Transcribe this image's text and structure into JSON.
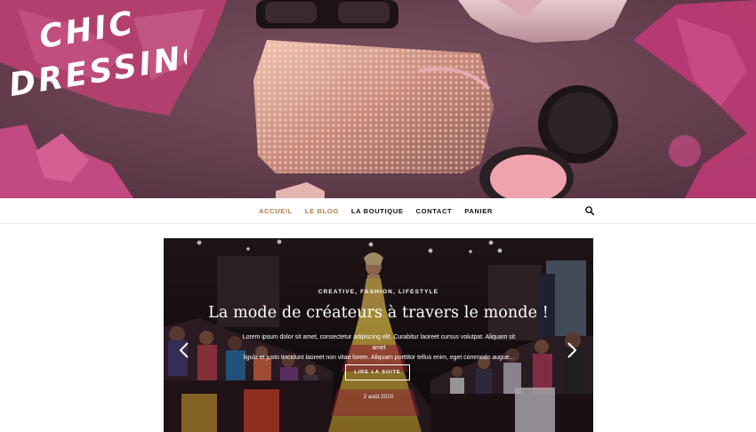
{
  "header": {
    "logo_line1": "CHIC",
    "logo_line2": "DRESSING"
  },
  "nav": {
    "items": [
      {
        "label": "ACCUEIL",
        "active": true
      },
      {
        "label": "LE BLOG",
        "active": true
      },
      {
        "label": "LA BOUTIQUE",
        "active": false
      },
      {
        "label": "CONTACT",
        "active": false
      },
      {
        "label": "PANIER",
        "active": false
      }
    ],
    "search_icon": "search-icon"
  },
  "slider": {
    "categories": "CREATIVE, FASHION, LIFESTYLE",
    "title": "La mode de créateurs à travers le monde !",
    "excerpt_line1": "Lorem ipsum dolor sit amet, consectetur adipiscing elit. Curabitur laoreet cursus volutpat. Aliquam sit amet",
    "excerpt_line2": "ligula et justo tincidunt laoreet non vitae lorem. Aliquam porttitor tellus enim, eget commodo augue...",
    "read_more": "LIRE LA SUITE",
    "date": "2 août 2020",
    "prev_icon": "chevron-left-icon",
    "next_icon": "chevron-right-icon"
  },
  "colors": {
    "accent": "#b07d47",
    "hero_bg": "#6a4150",
    "text": "#111111"
  }
}
